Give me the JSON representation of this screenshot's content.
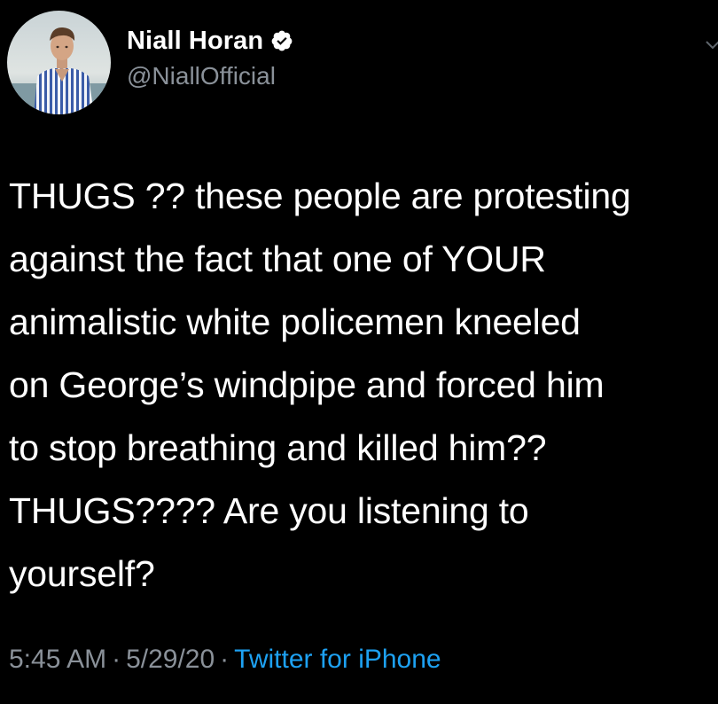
{
  "author": {
    "display_name": "Niall Horan",
    "handle": "@NiallOfficial",
    "verified": true,
    "avatar_icon": "profile-photo"
  },
  "tweet": {
    "text": "THUGS ?? these people are protesting\nagainst the fact that one of YOUR\nanimalistic white policemen kneeled\non George’s windpipe and forced him\nto stop breathing and killed him??\nTHUGS???? Are you listening to\nyourself?"
  },
  "meta": {
    "time": "5:45 AM",
    "date": "5/29/20",
    "separator": "·",
    "source": "Twitter for iPhone"
  },
  "colors": {
    "background": "#000000",
    "text": "#ffffff",
    "secondary": "#8a9199",
    "link": "#1da1f2"
  },
  "icons": {
    "verified": "verified-badge-icon",
    "more": "chevron-down-icon"
  }
}
